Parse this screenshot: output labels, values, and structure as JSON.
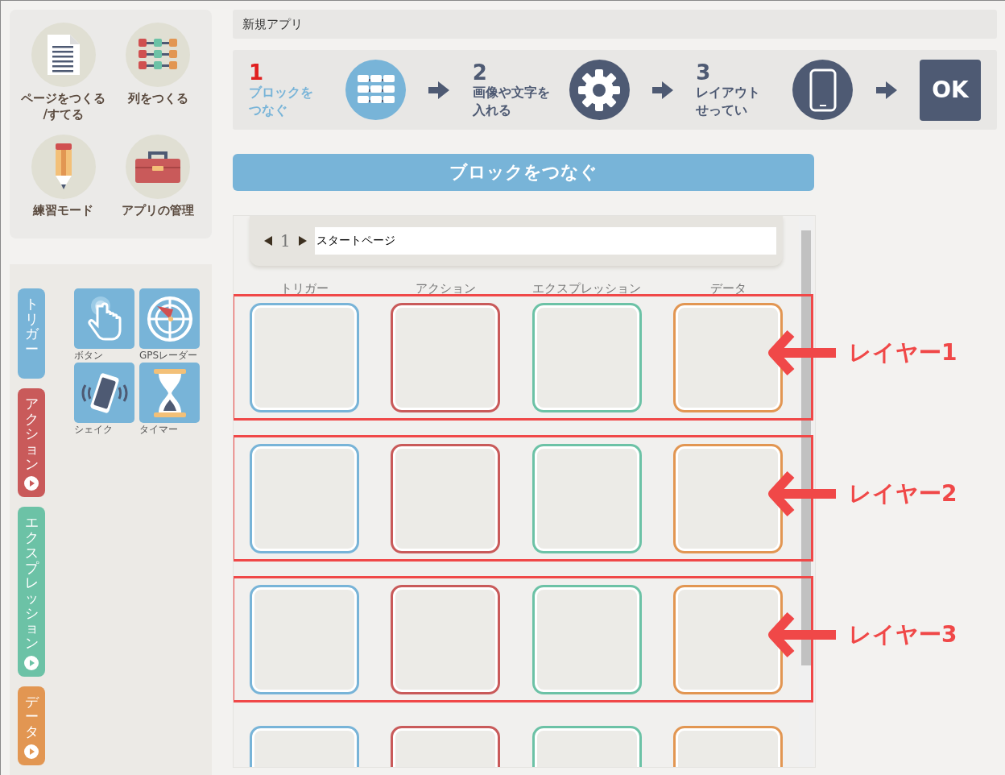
{
  "menu": [
    {
      "lines": [
        "ページをつくる",
        "/すてる"
      ],
      "kind": "document"
    },
    {
      "lines": [
        "列をつくる"
      ],
      "kind": "columns"
    },
    {
      "lines": [
        "練習モード"
      ],
      "kind": "pencil"
    },
    {
      "lines": [
        "アプリの管理"
      ],
      "kind": "toolbox"
    }
  ],
  "palette": {
    "tabs": [
      {
        "label": "トリガー",
        "color": "#78b4d8",
        "expandable": false
      },
      {
        "label": "アクション",
        "color": "#c95a5a",
        "expandable": true
      },
      {
        "label": "エクスプレッション",
        "color": "#6cc2a6",
        "expandable": true
      },
      {
        "label": "データ",
        "color": "#e29652",
        "expandable": true
      }
    ],
    "blocks": [
      {
        "label": "ボタン",
        "kind": "tap"
      },
      {
        "label": "GPSレーダー",
        "kind": "radar"
      },
      {
        "label": "シェイク",
        "kind": "shake"
      },
      {
        "label": "タイマー",
        "kind": "timer"
      }
    ]
  },
  "app_title": "新規アプリ",
  "steps": [
    {
      "number": "1",
      "lines": [
        "ブロックを",
        "つなぐ"
      ],
      "selected": true,
      "kind": "blocks"
    },
    {
      "number": "2",
      "lines": [
        "画像や文字を",
        "入れる"
      ],
      "selected": false,
      "kind": "gear"
    },
    {
      "number": "3",
      "lines": [
        "レイアウト",
        "せってい"
      ],
      "selected": false,
      "kind": "phone"
    }
  ],
  "ok_button": "OK",
  "section_title": "ブロックをつなぐ",
  "page_nav": {
    "number": "1",
    "page_name": "スタートページ"
  },
  "columns": [
    {
      "label": "トリガー",
      "color": "#78b4d8"
    },
    {
      "label": "アクション",
      "color": "#c95a5a"
    },
    {
      "label": "エクスプレッション",
      "color": "#6cc2a6"
    },
    {
      "label": "データ",
      "color": "#e29652"
    }
  ],
  "rows": [
    {
      "annotated": true,
      "annotation": "レイヤー1"
    },
    {
      "annotated": true,
      "annotation": "レイヤー2"
    },
    {
      "annotated": true,
      "annotation": "レイヤー3"
    },
    {
      "annotated": false
    }
  ]
}
